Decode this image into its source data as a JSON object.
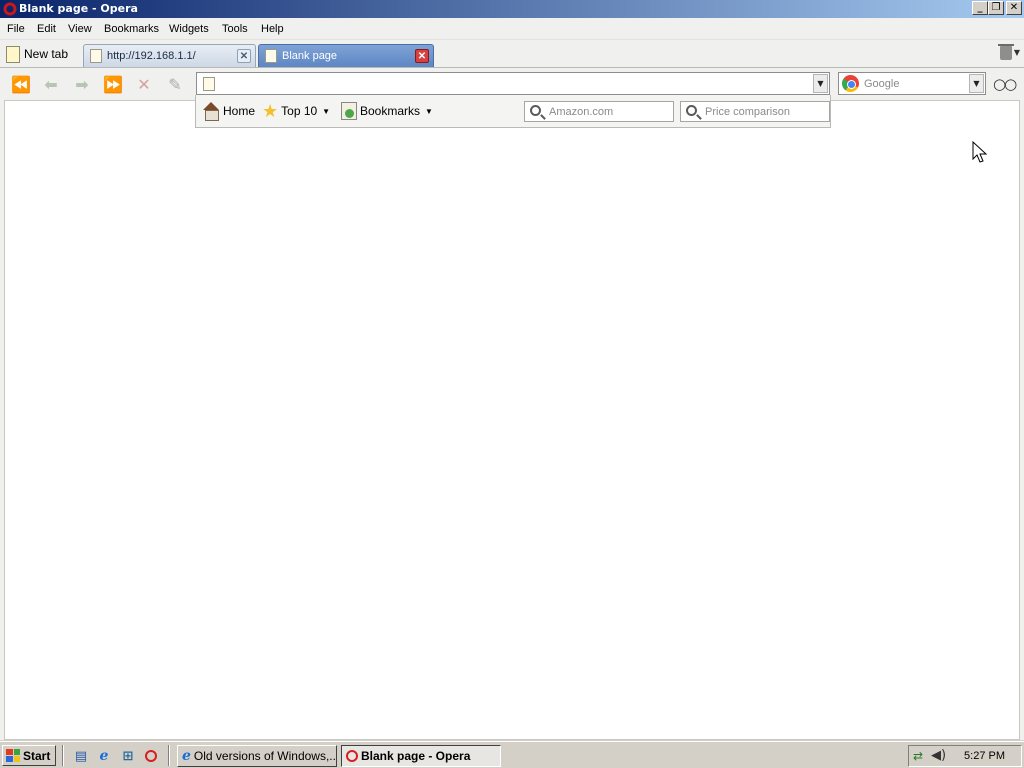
{
  "window": {
    "title": "Blank page - Opera",
    "caption_buttons": [
      "minimize",
      "restore",
      "close"
    ]
  },
  "menu": {
    "items": [
      "File",
      "Edit",
      "View",
      "Bookmarks",
      "Widgets",
      "Tools",
      "Help"
    ]
  },
  "tabs": {
    "new_tab_label": "New tab",
    "items": [
      {
        "label": "http://192.168.1.1/",
        "active": false
      },
      {
        "label": "Blank page",
        "active": true
      }
    ]
  },
  "navbar": {
    "address_value": "",
    "search_engine": "Google",
    "buttons": [
      "rewind",
      "back",
      "forward",
      "fast-forward",
      "stop",
      "edit"
    ]
  },
  "speed_dial": {
    "home_label": "Home",
    "top10_label": "Top 10",
    "bookmarks_label": "Bookmarks",
    "search1_placeholder": "Amazon.com",
    "search2_placeholder": "Price comparison"
  },
  "taskbar": {
    "start_label": "Start",
    "buttons": [
      {
        "label": "Old versions of Windows,...",
        "active": false
      },
      {
        "label": "Blank page - Opera",
        "active": true
      }
    ],
    "clock": "5:27 PM"
  },
  "colors": {
    "titlebar_start": "#0a246a",
    "titlebar_end": "#a6caf0",
    "active_tab": "#5d86c4",
    "tab_close_active": "#d84040"
  }
}
